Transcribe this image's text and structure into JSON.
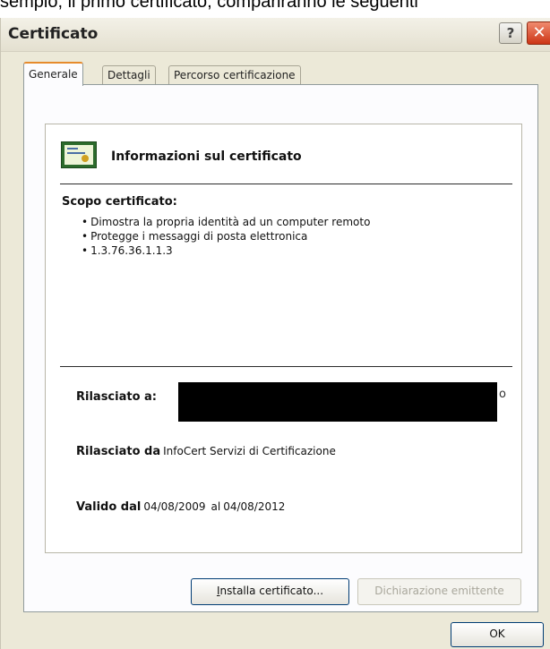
{
  "caption": "sempio, il primo certificato, compariranno le seguenti",
  "window": {
    "title": "Certificato",
    "help_glyph": "?",
    "close_glyph": "✕"
  },
  "tabs": [
    {
      "label": "Generale",
      "active": true
    },
    {
      "label": "Dettagli",
      "active": false
    },
    {
      "label": "Percorso certificazione",
      "active": false
    }
  ],
  "info": {
    "icon": "certificate-icon",
    "title": "Informazioni sul certificato",
    "purpose_label": "Scopo certificato:",
    "purposes": [
      "Dimostra la propria identità ad un computer remoto",
      "Protegge i messaggi di posta elettronica",
      "1.3.76.36.1.1.3"
    ],
    "issued_to_label": "Rilasciato a:",
    "issued_to_tail": "o",
    "issued_by_label": "Rilasciato da",
    "issued_by_value": "InfoCert Servizi di Certificazione",
    "valid_from_label": "Valido dal",
    "valid_from_value": "04/08/2009",
    "valid_to_label": "al",
    "valid_to_value": "04/08/2012"
  },
  "buttons": {
    "install_label_mnemonic": "I",
    "install_label_rest": "nstalla certificato...",
    "issuer_statement_label": "Dichiarazione emittente",
    "ok_label": "OK"
  }
}
